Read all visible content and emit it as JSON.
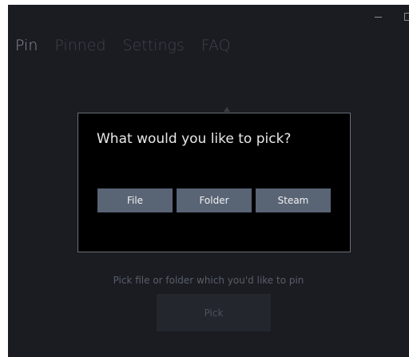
{
  "window": {
    "minimize_icon": "minimize-icon",
    "maximize_icon": "maximize-icon",
    "close_glyph": "×"
  },
  "nav": {
    "items": [
      {
        "label": "Pin"
      },
      {
        "label": "Pinned"
      },
      {
        "label": "Settings"
      },
      {
        "label": "FAQ"
      }
    ],
    "active": "Pin"
  },
  "main": {
    "hint": "Pick file or folder which you'd like to pin",
    "pick_label": "Pick"
  },
  "dialog": {
    "title": "What would you like to pick?",
    "buttons": [
      {
        "label": "File"
      },
      {
        "label": "Folder"
      },
      {
        "label": "Steam"
      }
    ]
  },
  "colors": {
    "window_bg": "#1a1c22",
    "dialog_bg": "#000000",
    "dialog_border": "#6a6d73",
    "button_bg": "#596475",
    "nav_active": "#8a8f98",
    "nav_inactive": "#3f434c"
  }
}
